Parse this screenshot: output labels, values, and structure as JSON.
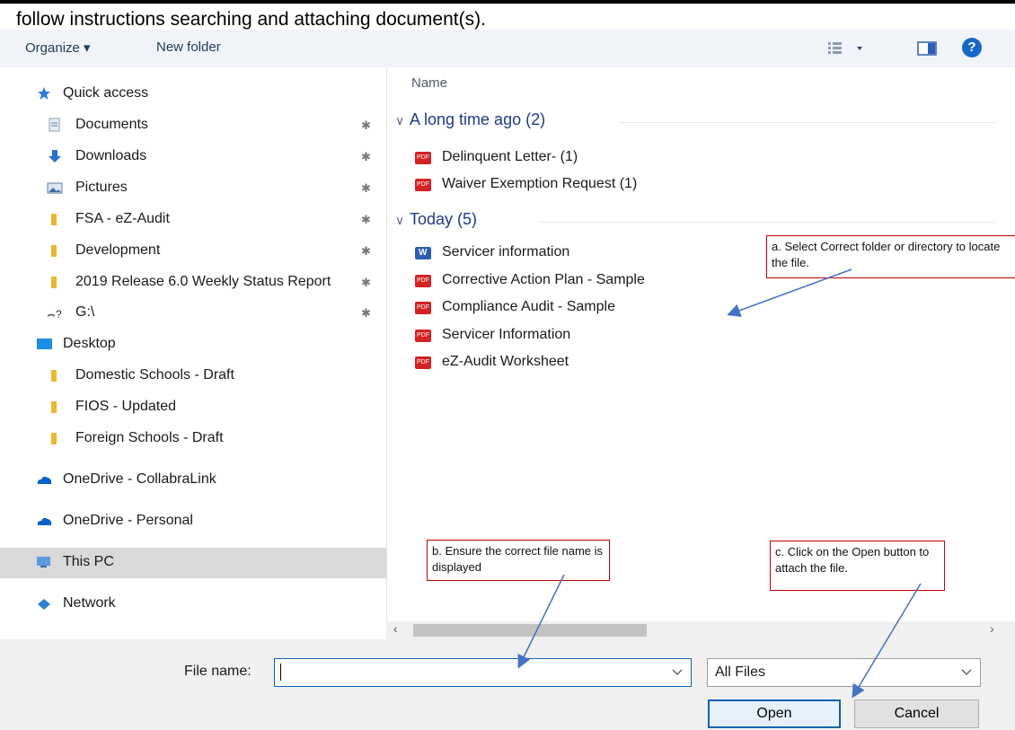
{
  "instruction": "follow instructions searching and attaching document(s).",
  "toolbar": {
    "organize_label": "Organize ▾",
    "new_folder_label": "New folder",
    "view_icon": "view-options-icon",
    "preview_icon": "preview-pane-icon",
    "help_label": "?"
  },
  "sidebar": {
    "items": [
      {
        "label": "Quick access",
        "icon": "star-icon",
        "pinned": false
      },
      {
        "label": "Documents",
        "icon": "documents-icon",
        "pinned": true
      },
      {
        "label": "Downloads",
        "icon": "download-icon",
        "pinned": true
      },
      {
        "label": "Pictures",
        "icon": "pictures-icon",
        "pinned": true
      },
      {
        "label": "FSA - eZ-Audit",
        "icon": "folder-icon",
        "pinned": true
      },
      {
        "label": "Development",
        "icon": "folder-icon",
        "pinned": true
      },
      {
        "label": "2019 Release 6.0 Weekly Status Report",
        "icon": "folder-icon",
        "pinned": true
      },
      {
        "label": "G:\\",
        "icon": "network-drive-icon",
        "pinned": true
      },
      {
        "label": "Desktop",
        "icon": "desktop-icon",
        "pinned": false
      },
      {
        "label": "Domestic Schools - Draft",
        "icon": "folder-icon",
        "pinned": false
      },
      {
        "label": "FIOS - Updated",
        "icon": "folder-icon",
        "pinned": false
      },
      {
        "label": "Foreign Schools - Draft",
        "icon": "folder-icon",
        "pinned": false
      },
      {
        "label": "OneDrive - CollabraLink",
        "icon": "onedrive-icon",
        "pinned": false
      },
      {
        "label": "OneDrive - Personal",
        "icon": "onedrive-icon",
        "pinned": false
      },
      {
        "label": "This PC",
        "icon": "computer-icon",
        "pinned": false
      },
      {
        "label": "Network",
        "icon": "network-icon",
        "pinned": false
      }
    ],
    "pin_glyph": "★"
  },
  "filelist": {
    "column_name": "Name",
    "groups": [
      {
        "label": "A long time ago (2)",
        "files": [
          {
            "name": "Delinquent Letter- (1)",
            "type": "pdf"
          },
          {
            "name": "Waiver Exemption Request (1)",
            "type": "pdf"
          }
        ]
      },
      {
        "label": "Today (5)",
        "files": [
          {
            "name": "Servicer information",
            "type": "word"
          },
          {
            "name": "Corrective Action Plan - Sample",
            "type": "pdf"
          },
          {
            "name": "Compliance Audit - Sample",
            "type": "pdf"
          },
          {
            "name": "Servicer Information",
            "type": "pdf"
          },
          {
            "name": "eZ-Audit Worksheet",
            "type": "pdf"
          }
        ]
      }
    ]
  },
  "callouts": {
    "a": "a. Select Correct folder or directory to locate the file.",
    "b": "b. Ensure the correct file name is displayed",
    "c": "c. Click on the Open button to attach the file."
  },
  "bottom": {
    "filename_label": "File name:",
    "filename_value": "",
    "filetype_value": "All Files",
    "open_label": "Open",
    "cancel_label": "Cancel"
  },
  "colors": {
    "accent": "#0b63b0",
    "callout_border": "#c00000",
    "arrow": "#4472c4"
  }
}
